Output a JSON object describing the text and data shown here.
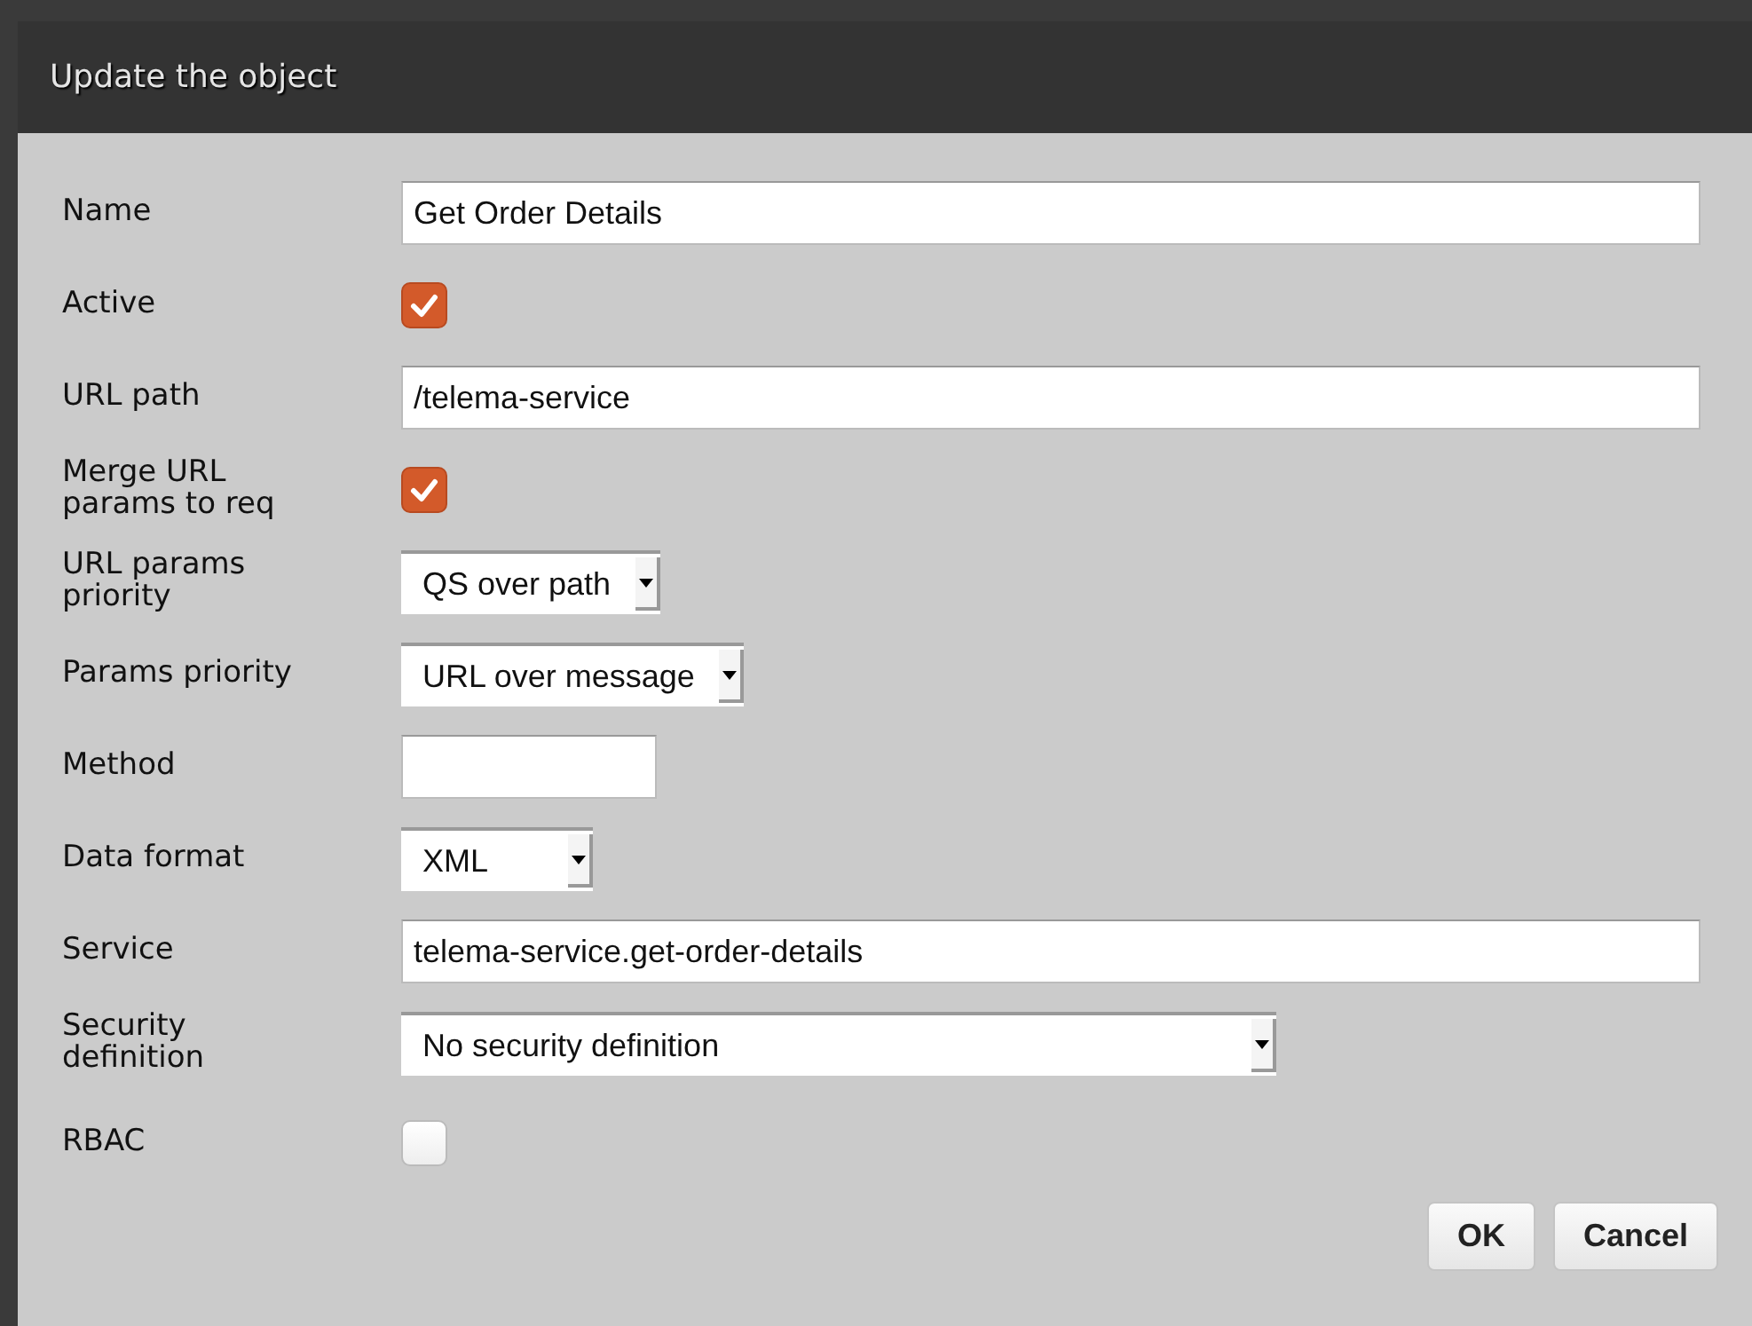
{
  "dialog": {
    "title": "Update the object"
  },
  "fields": [
    {
      "label": "Name",
      "kind": "text",
      "value": "Get Order Details"
    },
    {
      "label": "Active",
      "kind": "checkbox",
      "checked": true
    },
    {
      "label": "URL path",
      "kind": "text",
      "value": "/telema-service"
    },
    {
      "label": "Merge URL params to req",
      "kind": "checkbox",
      "checked": true
    },
    {
      "label": "URL params priority",
      "kind": "select",
      "value": "QS over path"
    },
    {
      "label": "Params priority",
      "kind": "select",
      "value": "URL over message"
    },
    {
      "label": "Method",
      "kind": "short-text"
    },
    {
      "label": "Data format",
      "kind": "select",
      "value": "XML"
    },
    {
      "label": "Service",
      "kind": "text",
      "value": "telema-service.get-order-details"
    },
    {
      "label": "Security definition",
      "kind": "select",
      "value": "No security definition"
    },
    {
      "label": "RBAC",
      "kind": "checkbox",
      "checked": false
    }
  ],
  "buttons": [
    "OK",
    "Cancel"
  ]
}
